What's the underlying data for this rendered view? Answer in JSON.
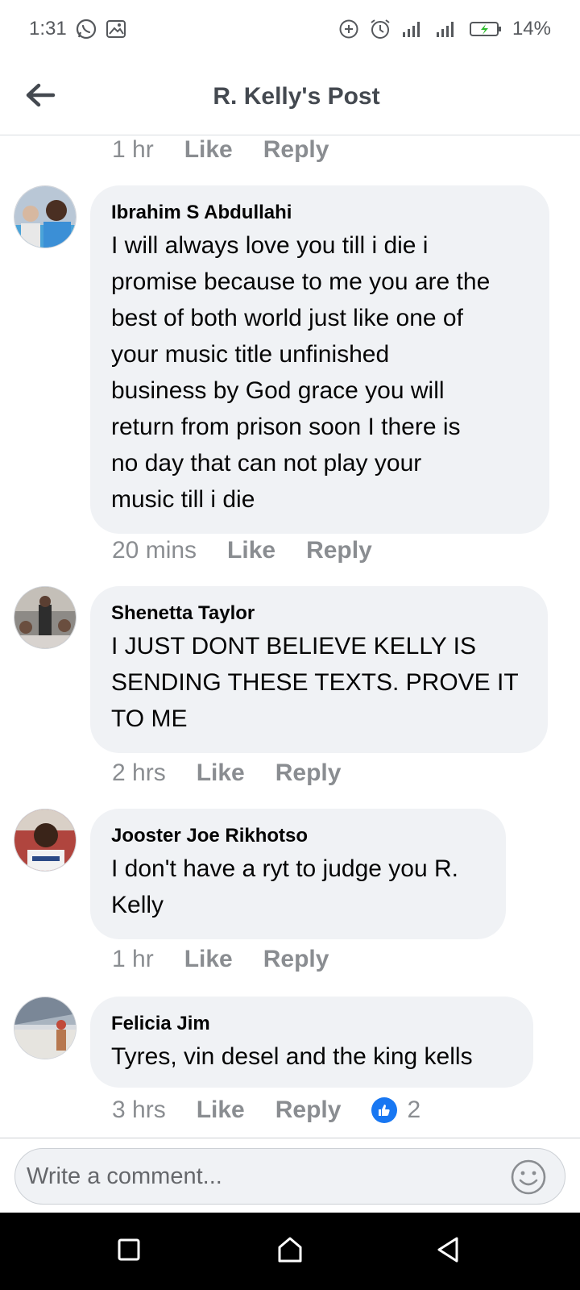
{
  "status_bar": {
    "time": "1:31",
    "battery": "14%",
    "left_icons": [
      "whatsapp-icon",
      "image-icon"
    ],
    "right_icons": [
      "add-circle-icon",
      "alarm-icon",
      "signal-icon",
      "signal-icon",
      "battery-charging-icon"
    ]
  },
  "header": {
    "title": "R. Kelly's Post",
    "back_icon": "back-arrow-icon"
  },
  "top_actions": {
    "time": "1 hr",
    "like": "Like",
    "reply": "Reply"
  },
  "comments": [
    {
      "author": "Ibrahim S Abdullahi",
      "lines": [
        "I will always love you till i die i",
        "promise because to me you are the",
        "best of both world just like one of",
        "your music title unfinished",
        "business by God grace you will",
        "return from prison soon I there is",
        "no day that  can not play your",
        "music till i die"
      ],
      "time": "20 mins",
      "like": "Like",
      "reply": "Reply"
    },
    {
      "author": "Shenetta Taylor",
      "lines": [
        "I JUST DONT BELIEVE  KELLY IS",
        "SENDING THESE TEXTS.  PROVE IT",
        "TO ME"
      ],
      "time": "2 hrs",
      "like": "Like",
      "reply": "Reply"
    },
    {
      "author": "Jooster Joe Rikhotso",
      "lines": [
        "I don't have a ryt to judge you R.",
        "Kelly"
      ],
      "time": "1 hr",
      "like": "Like",
      "reply": "Reply"
    },
    {
      "author": "Felicia Jim",
      "lines": [
        "Tyres,  vin desel and the king kells"
      ],
      "time": "3 hrs",
      "like": "Like",
      "reply": "Reply",
      "reaction_count": "2"
    }
  ],
  "composer": {
    "placeholder": "Write a comment...",
    "emoji_icon": "emoji-smile-icon"
  },
  "nav_bar": {
    "icons": [
      "recents-square-icon",
      "home-icon",
      "back-triangle-icon"
    ]
  },
  "colors": {
    "bubble": "#f0f2f5",
    "meta_text": "#8a8d91",
    "like_blue": "#1877f2"
  }
}
